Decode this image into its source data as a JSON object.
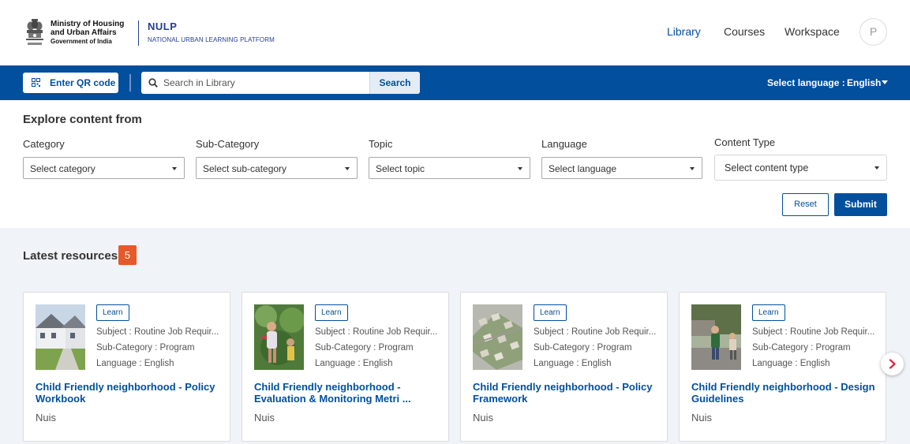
{
  "header": {
    "ministry_line1": "Ministry of Housing",
    "ministry_line2": "and Urban Affairs",
    "ministry_line3": "Government of India",
    "brand_short": "NULP",
    "brand_long": "NATIONAL URBAN LEARNING PLATFORM",
    "nav": [
      "Library",
      "Courses",
      "Workspace"
    ],
    "avatar_initial": "P"
  },
  "toolbar": {
    "qr_label": "Enter QR code",
    "search_placeholder": "Search in Library",
    "search_button": "Search",
    "language_label": "Select language :",
    "language_value": "English"
  },
  "filters": {
    "heading": "Explore content from",
    "category": {
      "label": "Category",
      "value": "Select category"
    },
    "subcategory": {
      "label": "Sub-Category",
      "value": "Select sub-category"
    },
    "topic": {
      "label": "Topic",
      "value": "Select topic"
    },
    "language": {
      "label": "Language",
      "value": "Select language"
    },
    "content_type": {
      "label": "Content Type",
      "value": "Select content type"
    },
    "reset": "Reset",
    "submit": "Submit"
  },
  "resources": {
    "title": "Latest resources",
    "count": "5",
    "cards": [
      {
        "badge": "Learn",
        "subject": "Subject : Routine Job Requir...",
        "subcategory": "Sub-Category : Program",
        "language": "Language : English",
        "title": "Child Friendly neighborhood - Policy Workbook",
        "org": "Nuis"
      },
      {
        "badge": "Learn",
        "subject": "Subject : Routine Job Requir...",
        "subcategory": "Sub-Category : Program",
        "language": "Language : English",
        "title": "Child Friendly neighborhood - Evaluation & Monitoring Metri ...",
        "org": "Nuis"
      },
      {
        "badge": "Learn",
        "subject": "Subject : Routine Job Requir...",
        "subcategory": "Sub-Category : Program",
        "language": "Language : English",
        "title": "Child Friendly neighborhood - Policy Framework",
        "org": "Nuis"
      },
      {
        "badge": "Learn",
        "subject": "Subject : Routine Job Requir...",
        "subcategory": "Sub-Category : Program",
        "language": "Language : English",
        "title": "Child Friendly neighborhood - Design Guidelines",
        "org": "Nuis"
      }
    ]
  },
  "icons": {
    "emblem": "national-emblem-icon",
    "qr": "qr-code-icon",
    "search": "search-icon",
    "caret": "caret-down-icon",
    "next": "chevron-right-icon"
  },
  "colors": {
    "primary": "#024f9d",
    "count_badge": "#e45a2a",
    "next_arrow": "#d9263c"
  }
}
